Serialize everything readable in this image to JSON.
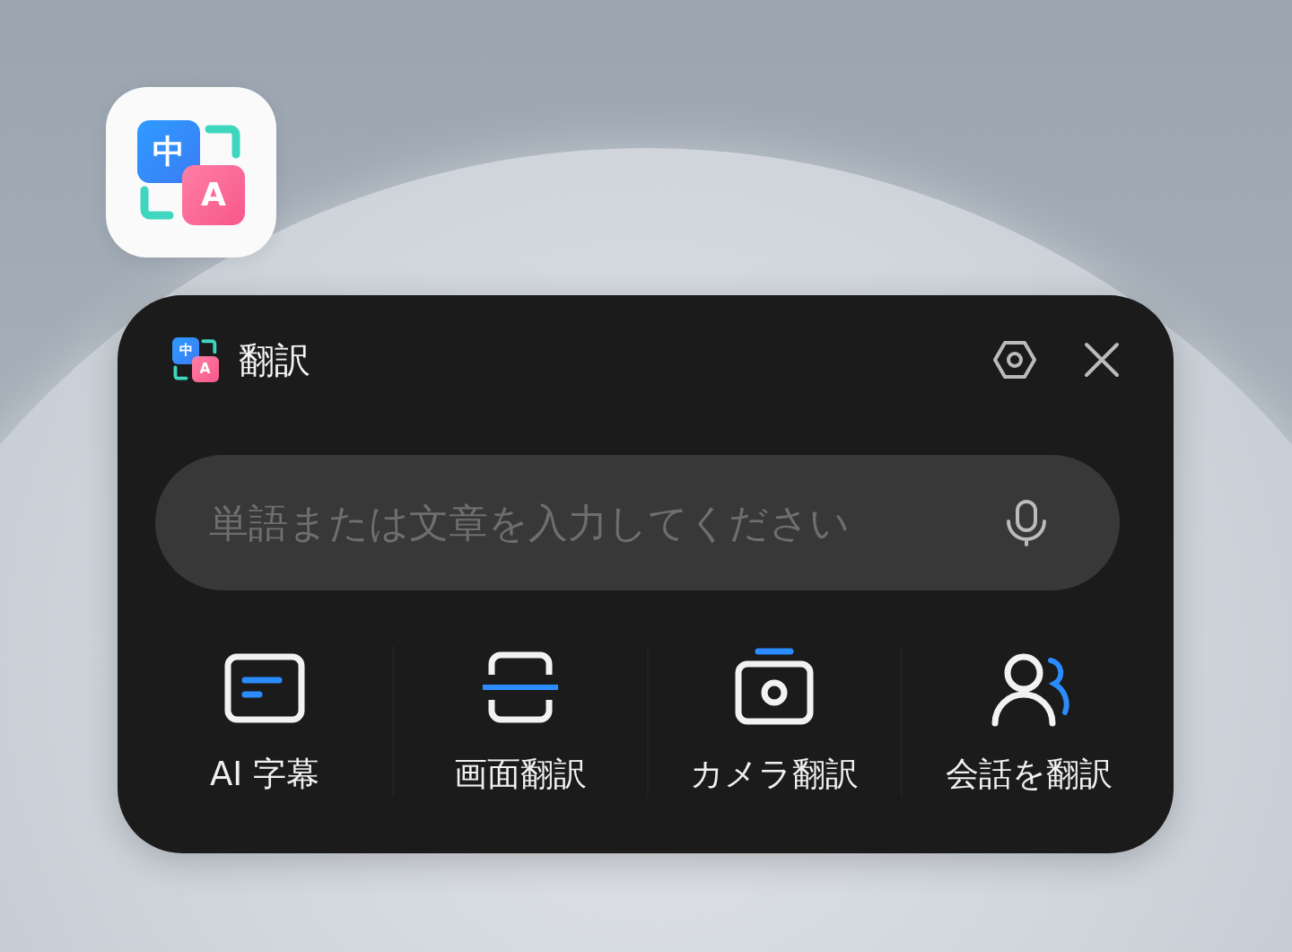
{
  "home_icon": {
    "source_glyph": "中",
    "target_glyph": "A"
  },
  "widget": {
    "icon": {
      "source_glyph": "中",
      "target_glyph": "A"
    },
    "title": "翻訳"
  },
  "search": {
    "placeholder": "単語または文章を入力してください"
  },
  "actions": [
    {
      "kind": "subtitles",
      "label": "AI 字幕"
    },
    {
      "kind": "screen",
      "label": "画面翻訳"
    },
    {
      "kind": "camera",
      "label": "カメラ翻訳"
    },
    {
      "kind": "conversation",
      "label": "会話を翻訳"
    }
  ]
}
